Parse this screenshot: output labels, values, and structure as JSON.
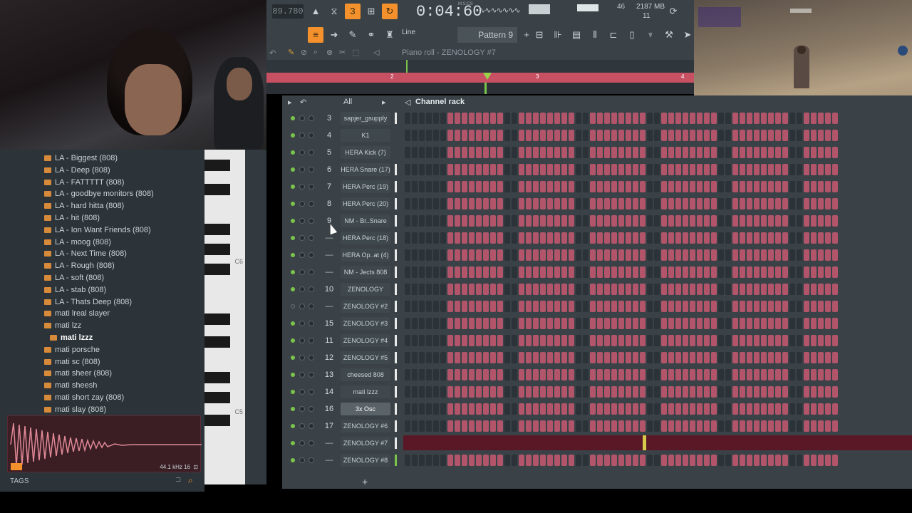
{
  "toolbar": {
    "tempo": "89.780",
    "song_time": "0:04:60",
    "time_label": "M:S:CS",
    "cpu_value": "46",
    "memory": "2187 MB",
    "voices": "11",
    "snap_label": "Line",
    "pattern_label": "Pattern 9"
  },
  "piano_roll_bar": {
    "title": "Piano roll - ZENOLOGY #7"
  },
  "ruler": {
    "markers": [
      "2",
      "3",
      "4"
    ]
  },
  "browser": {
    "items": [
      "LA - Biggest (808)",
      "LA - Deep (808)",
      "LA - FATTTTT (808)",
      "LA - goodbye monitors (808)",
      "LA - hard hitta (808)",
      "LA - hit (808)",
      "LA - Ion Want Friends (808)",
      "LA - moog (808)",
      "LA - Next Time (808)",
      "LA - Rough (808)",
      "LA - soft (808)",
      "LA - stab (808)",
      "LA - Thats Deep (808)",
      "mati lreal slayer",
      "mati lzz",
      "mati lzzz",
      "mati porsche",
      "mati sc (808)",
      "mati sheer (808)",
      "mati sheesh",
      "mati short zay (808)",
      "mati slay (808)"
    ],
    "selected_index": 15,
    "sample_info": "44.1 kHz 16",
    "tags_label": "TAGS"
  },
  "keys": {
    "c6": "C6",
    "c5": "C5"
  },
  "rack": {
    "title": "Channel rack",
    "filter": "All",
    "channels": [
      {
        "num": "3",
        "name": "sapjer_gsupply",
        "led": true
      },
      {
        "num": "4",
        "name": "K1",
        "led": true
      },
      {
        "num": "5",
        "name": "HERA Kick (7)",
        "led": true
      },
      {
        "num": "6",
        "name": "HERA Snare (17)",
        "led": true
      },
      {
        "num": "7",
        "name": "HERA Perc (19)",
        "led": true
      },
      {
        "num": "8",
        "name": "HERA Perc (20)",
        "led": true
      },
      {
        "num": "9",
        "name": "NM - Br..Snare",
        "led": true
      },
      {
        "num": "—",
        "name": "HERA Perc (18)",
        "led": true
      },
      {
        "num": "—",
        "name": "HERA Op..at (4)",
        "led": true
      },
      {
        "num": "—",
        "name": "NM - Jects 808",
        "led": true
      },
      {
        "num": "10",
        "name": "ZENOLOGY",
        "led": true
      },
      {
        "num": "—",
        "name": "ZENOLOGY #2",
        "led": false
      },
      {
        "num": "15",
        "name": "ZENOLOGY #3",
        "led": true
      },
      {
        "num": "11",
        "name": "ZENOLOGY #4",
        "led": true
      },
      {
        "num": "12",
        "name": "ZENOLOGY #5",
        "led": true
      },
      {
        "num": "13",
        "name": "cheesed 808",
        "led": true
      },
      {
        "num": "14",
        "name": "mati lzzz",
        "led": true
      },
      {
        "num": "16",
        "name": "3x Osc",
        "led": true
      },
      {
        "num": "17",
        "name": "ZENOLOGY #6",
        "led": true
      },
      {
        "num": "—",
        "name": "ZENOLOGY #7",
        "led": true
      },
      {
        "num": "—",
        "name": "ZENOLOGY #8",
        "led": true
      }
    ],
    "add_label": "+"
  },
  "colors": {
    "accent": "#f4912c",
    "step_on": "#b2556a",
    "step_off": "#2c3338",
    "led": "#7bc44b"
  }
}
